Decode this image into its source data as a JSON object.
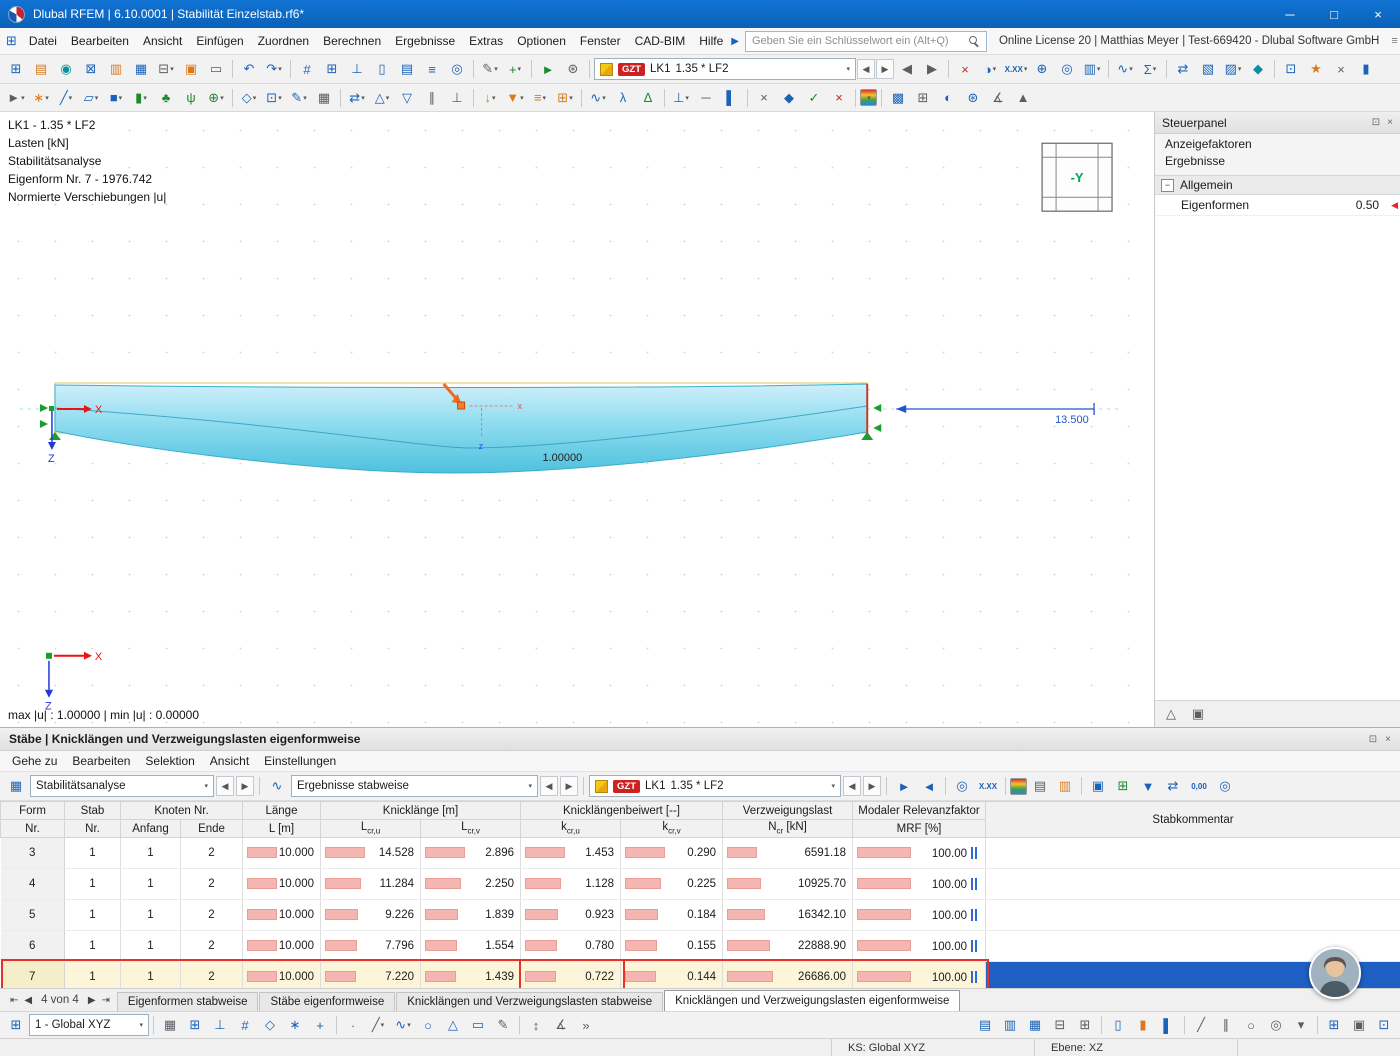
{
  "ui": {
    "caret": "▾",
    "prev": "◀",
    "next": "▶",
    "float": "⊡",
    "close": "×",
    "expander": "−",
    "more": "»",
    "appmenu": "⊞",
    "menu_list": "≡",
    "pin": "◆"
  },
  "titlebar": {
    "title": "Dlubal RFEM | 6.10.0001 | Stabilität Einzelstab.rf6*",
    "buttons": [
      {
        "g": "─",
        "n": "minimize-button"
      },
      {
        "g": "□",
        "n": "maximize-button"
      },
      {
        "g": "×",
        "n": "close-button"
      }
    ]
  },
  "menubar": {
    "items": [
      "Datei",
      "Bearbeiten",
      "Ansicht",
      "Einfügen",
      "Zuordnen",
      "Berechnen",
      "Ergebnisse",
      "Extras",
      "Optionen",
      "Fenster",
      "CAD-BIM",
      "Hilfe"
    ],
    "search_placeholder": "Geben Sie ein Schlüsselwort ein (Alt+Q)",
    "license_text": "Online License 20 | Matthias Meyer | Test-669420 - Dlubal Software GmbH"
  },
  "load_combo": {
    "badge": "GZT",
    "case": "LK1",
    "factor": "1.35 * LF2"
  },
  "viewport": {
    "overlay": [
      "LK1 - 1.35 * LF2",
      "Lasten [kN]",
      "Stabilitätsanalyse",
      "Eigenform Nr. 7 - 1976.742",
      "Normierte Verschiebungen |u|"
    ],
    "axis_x": "X",
    "axis_z": "Z",
    "mini_x": "x",
    "mini_z": "z",
    "beam_value": "1.00000",
    "dimension": "13.500",
    "navcube": "-Y",
    "status": "max |u| : 1.00000 | min |u| : 0.00000"
  },
  "sidepanel": {
    "title": "Steuerpanel",
    "links": [
      "Anzeigefaktoren",
      "Ergebnisse"
    ],
    "group": "Allgemein",
    "item_label": "Eigenformen",
    "item_value": "0.50"
  },
  "table": {
    "title": "Stäbe | Knicklängen und Verzweigungslasten eigenformweise",
    "menu": [
      "Gehe zu",
      "Bearbeiten",
      "Selektion",
      "Ansicht",
      "Einstellungen"
    ],
    "combo1": "Stabilitätsanalyse",
    "combo2": "Ergebnisse stabweise",
    "header": {
      "form_top": "Form",
      "form_bot": "Nr.",
      "stab_top": "Stab",
      "stab_bot": "Nr.",
      "knoten_top": "Knoten Nr.",
      "knoten_a": "Anfang",
      "knoten_e": "Ende",
      "laenge_top": "Länge",
      "laenge_bot": "L [m]",
      "knick_top": "Knicklänge [m]",
      "knick_u_pre": "L",
      "knick_u_sub": "cr,u",
      "knick_v_pre": "L",
      "knick_v_sub": "cr,v",
      "beiwert_top": "Knicklängenbeiwert [--]",
      "beiwert_u_pre": "k",
      "beiwert_u_sub": "cr,u",
      "beiwert_v_pre": "k",
      "beiwert_v_sub": "cr,v",
      "verzw_top": "Verzweigungslast",
      "verzw_pre": "N",
      "verzw_sub": "cr",
      "verzw_post": " [kN]",
      "mrf_top": "Modaler Relevanzfaktor",
      "mrf_bot": "MRF [%]",
      "kommentar": "Stabkommentar"
    },
    "rows": [
      {
        "form": "3",
        "stab": "1",
        "anfang": "1",
        "ende": "2",
        "laenge": "10.000",
        "lcru": "14.528",
        "lcrv": "2.896",
        "kcru": "1.453",
        "kcrv": "0.290",
        "ncr": "6591.18",
        "mrf": "100.00",
        "kommentar": ""
      },
      {
        "form": "4",
        "stab": "1",
        "anfang": "1",
        "ende": "2",
        "laenge": "10.000",
        "lcru": "11.284",
        "lcrv": "2.250",
        "kcru": "1.128",
        "kcrv": "0.225",
        "ncr": "10925.70",
        "mrf": "100.00",
        "kommentar": ""
      },
      {
        "form": "5",
        "stab": "1",
        "anfang": "1",
        "ende": "2",
        "laenge": "10.000",
        "lcru": "9.226",
        "lcrv": "1.839",
        "kcru": "0.923",
        "kcrv": "0.184",
        "ncr": "16342.10",
        "mrf": "100.00",
        "kommentar": ""
      },
      {
        "form": "6",
        "stab": "1",
        "anfang": "1",
        "ende": "2",
        "laenge": "10.000",
        "lcru": "7.796",
        "lcrv": "1.554",
        "kcru": "0.780",
        "kcrv": "0.155",
        "ncr": "22888.90",
        "mrf": "100.00",
        "kommentar": ""
      },
      {
        "form": "7",
        "stab": "1",
        "anfang": "1",
        "ende": "2",
        "laenge": "10.000",
        "lcru": "7.220",
        "lcrv": "1.439",
        "kcru": "0.722",
        "kcrv": "0.144",
        "ncr": "26686.00",
        "mrf": "100.00",
        "kommentar": "",
        "highlight": true
      }
    ],
    "pager": {
      "first": "⇤",
      "prev": "◀",
      "text": "4 von 4",
      "next": "▶",
      "last": "⇥"
    },
    "tabs": [
      "Eigenformen stabweise",
      "Stäbe eigenformweise",
      "Knicklängen und Verzweigungslasten stabweise",
      "Knicklängen und Verzweigungslasten eigenformweise"
    ],
    "active_tab": 3
  },
  "bottombar": {
    "combo": "1 - Global XYZ"
  },
  "statusbar": {
    "ks": "KS: Global XYZ",
    "ebene": "Ebene: XZ"
  },
  "toolbars": {
    "tb1a": [
      {
        "g": "⊞",
        "c": "blue",
        "n": "new-model-icon"
      },
      {
        "g": "▤",
        "c": "orange",
        "n": "open-model-icon"
      },
      {
        "g": "◉",
        "c": "teal",
        "n": "dlubal-online-icon"
      },
      {
        "g": "⊠",
        "c": "blue",
        "n": "import-icon"
      },
      {
        "g": "▥",
        "c": "orange",
        "n": "project-navigator-icon"
      },
      {
        "g": "▦",
        "c": "blue",
        "n": "save-icon"
      },
      {
        "g": "⊟",
        "c": "gray",
        "n": "print-icon",
        "d": 1
      },
      {
        "g": "▣",
        "c": "orange",
        "n": "copy-icon"
      },
      {
        "g": "▭",
        "c": "gray",
        "n": "clipboard-icon"
      },
      {
        "sep": 1
      },
      {
        "g": "↶",
        "c": "blue",
        "n": "undo-icon"
      },
      {
        "g": "↷",
        "c": "blue",
        "n": "redo-icon",
        "d": 1
      },
      {
        "sep": 1
      },
      {
        "g": "#",
        "c": "blue",
        "n": "grid-icon"
      },
      {
        "g": "⊞",
        "c": "blue",
        "n": "work-plane-icon"
      },
      {
        "g": "⊥",
        "c": "blue",
        "n": "snap-icon"
      },
      {
        "g": "▯",
        "c": "blue",
        "n": "window-layout-icon"
      },
      {
        "g": "▤",
        "c": "blue",
        "n": "tables-icon"
      },
      {
        "g": "≡",
        "c": "blue",
        "n": "printout-report-icon"
      },
      {
        "g": "◎",
        "c": "blue",
        "n": "visibility-icon"
      },
      {
        "sep": 1
      },
      {
        "g": "✎",
        "c": "gray",
        "n": "edit-mode-icon",
        "d": 1
      },
      {
        "g": "+",
        "c": "green",
        "n": "insert-object-icon",
        "d": 1
      },
      {
        "sep": 1
      },
      {
        "g": "►",
        "c": "green",
        "n": "calculate-icon"
      },
      {
        "g": "⊛",
        "c": "gray",
        "n": "calculation-settings-icon"
      },
      {
        "sep": 1
      }
    ],
    "tb1b": [
      {
        "g": "◀",
        "c": "gray",
        "n": "previous-load-case-icon"
      },
      {
        "g": "▶",
        "c": "gray",
        "n": "next-load-case-icon"
      },
      {
        "sep": 1
      },
      {
        "g": "×",
        "c": "red",
        "n": "delete-results-icon"
      },
      {
        "g": "◑",
        "c": "blue",
        "n": "show-results-icon",
        "d": 1
      },
      {
        "txt": "X.XX",
        "c": "blue",
        "n": "result-values-icon",
        "d": 1
      },
      {
        "g": "⊕",
        "c": "blue",
        "n": "zoom-values-icon"
      },
      {
        "g": "◎",
        "c": "blue",
        "n": "find-value-icon"
      },
      {
        "g": "▥",
        "c": "blue",
        "n": "result-diagram-icon",
        "d": 1
      },
      {
        "sep": 1
      },
      {
        "g": "∿",
        "c": "blue",
        "n": "result-smoothing-icon",
        "d": 1
      },
      {
        "g": "Σ",
        "c": "blue",
        "n": "result-sums-icon",
        "d": 1
      },
      {
        "sep": 1
      },
      {
        "g": "⇄",
        "c": "blue",
        "n": "compare-results-icon"
      },
      {
        "g": "▧",
        "c": "blue",
        "n": "section-view-icon"
      },
      {
        "g": "▨",
        "c": "blue",
        "n": "rendering-icon",
        "d": 1
      },
      {
        "g": "◆",
        "c": "teal",
        "n": "solid-display-icon"
      },
      {
        "sep": 1
      },
      {
        "g": "⊡",
        "c": "blue",
        "n": "clipping-box-icon"
      },
      {
        "g": "★",
        "c": "orange",
        "n": "favorites-icon"
      },
      {
        "g": "×",
        "c": "gray",
        "n": "close-views-icon"
      },
      {
        "g": "▮",
        "c": "blue",
        "n": "bar-display-icon"
      }
    ],
    "tb2": [
      {
        "g": "►",
        "c": "gray",
        "n": "select-pointer-icon",
        "d": 1
      },
      {
        "g": "∗",
        "c": "orange",
        "n": "new-node-icon",
        "d": 1
      },
      {
        "g": "╱",
        "c": "blue",
        "n": "new-line-icon",
        "d": 1
      },
      {
        "g": "▱",
        "c": "blue",
        "n": "new-surface-icon",
        "d": 1
      },
      {
        "g": "■",
        "c": "blue",
        "n": "new-solid-icon",
        "d": 1
      },
      {
        "g": "▮",
        "c": "green",
        "n": "new-member-icon",
        "d": 1
      },
      {
        "g": "♣",
        "c": "green",
        "n": "new-tree-icon"
      },
      {
        "g": "ψ",
        "c": "green",
        "n": "new-vegetation-icon"
      },
      {
        "g": "⊕",
        "c": "green",
        "n": "generate-objects-icon",
        "d": 1
      },
      {
        "sep": 1
      },
      {
        "g": "◇",
        "c": "blue",
        "n": "guide-line-icon",
        "d": 1
      },
      {
        "g": "⊡",
        "c": "blue",
        "n": "dimension-icon",
        "d": 1
      },
      {
        "g": "✎",
        "c": "blue",
        "n": "annotation-icon",
        "d": 1
      },
      {
        "g": "▦",
        "c": "gray",
        "n": "section-cut-icon"
      },
      {
        "sep": 1
      },
      {
        "g": "⇄",
        "c": "blue",
        "n": "move-copy-icon",
        "d": 1
      },
      {
        "g": "△",
        "c": "blue",
        "n": "rotate-icon",
        "d": 1
      },
      {
        "g": "▽",
        "c": "blue",
        "n": "mirror-icon"
      },
      {
        "g": "∥",
        "c": "gray",
        "n": "align-parallel-icon"
      },
      {
        "g": "⊥",
        "c": "gray",
        "n": "align-perpendicular-icon"
      },
      {
        "sep": 1
      },
      {
        "g": "↓",
        "c": "orange",
        "n": "nodal-load-icon",
        "d": 1
      },
      {
        "g": "▼",
        "c": "orange",
        "n": "member-load-icon",
        "d": 1
      },
      {
        "g": "≡",
        "c": "orange",
        "n": "surface-load-icon",
        "d": 1
      },
      {
        "g": "⊞",
        "c": "orange",
        "n": "load-wizard-icon",
        "d": 1
      },
      {
        "sep": 1
      },
      {
        "g": "∿",
        "c": "blue",
        "n": "imperfection-icon",
        "d": 1
      },
      {
        "g": "λ",
        "c": "blue",
        "n": "stability-analysis-icon"
      },
      {
        "g": "Δ",
        "c": "green",
        "n": "deformation-icon"
      },
      {
        "sep": 1
      },
      {
        "g": "⊥",
        "c": "blue",
        "n": "nodal-support-icon",
        "d": 1
      },
      {
        "g": "─",
        "c": "gray",
        "n": "member-hinge-icon"
      },
      {
        "g": "▌",
        "c": "blue",
        "n": "member-support-icon"
      },
      {
        "sep": 1
      },
      {
        "g": "×",
        "c": "gray",
        "n": "intersection-icon"
      },
      {
        "g": "◆",
        "c": "blue",
        "n": "cross-section-icon"
      },
      {
        "g": "✓",
        "c": "green",
        "n": "check-model-icon"
      },
      {
        "g": "×",
        "c": "red",
        "n": "delete-objects-icon"
      },
      {
        "sep": 1
      },
      {
        "swatch": 1,
        "n": "color-scale-icon",
        "d": 1
      },
      {
        "sep": 1
      },
      {
        "g": "▩",
        "c": "blue",
        "n": "mesh-icon"
      },
      {
        "g": "⊞",
        "c": "gray",
        "n": "mesh-settings-icon"
      },
      {
        "g": "◐",
        "c": "blue",
        "n": "display-properties-icon"
      },
      {
        "g": "⊛",
        "c": "blue",
        "n": "regenerate-icon"
      },
      {
        "g": "∡",
        "c": "gray",
        "n": "angle-icon"
      },
      {
        "g": "▲",
        "c": "gray",
        "n": "mirror-copy-icon"
      }
    ],
    "ttb": [
      {
        "g": "►",
        "c": "blue",
        "n": "select-in-graphic-icon"
      },
      {
        "g": "◄",
        "c": "blue",
        "n": "sync-selection-icon"
      },
      {
        "sep": 1
      },
      {
        "g": "◎",
        "c": "blue",
        "n": "view-values-icon"
      },
      {
        "txt": "X.XX",
        "c": "blue",
        "n": "table-values-icon"
      },
      {
        "sep": 1
      },
      {
        "swatch": 1,
        "n": "relation-bars-icon"
      },
      {
        "g": "▤",
        "c": "gray",
        "n": "export-table-icon"
      },
      {
        "g": "▥",
        "c": "orange",
        "n": "import-table-icon"
      },
      {
        "sep": 1
      },
      {
        "g": "▣",
        "c": "blue",
        "n": "dock-table-icon"
      },
      {
        "g": "⊞",
        "c": "green",
        "n": "export-html-icon"
      },
      {
        "g": "▼",
        "c": "blue",
        "n": "filter-icon"
      },
      {
        "g": "⇄",
        "c": "blue",
        "n": "transfer-icon"
      },
      {
        "txt": "0,00",
        "c": "blue",
        "n": "decimal-places-icon"
      },
      {
        "g": "◎",
        "c": "blue",
        "n": "search-table-icon"
      }
    ],
    "bb1": [
      {
        "g": "▦",
        "c": "gray",
        "n": "snap-grid-icon"
      },
      {
        "g": "⊞",
        "c": "blue",
        "n": "snap-points-icon"
      },
      {
        "g": "⊥",
        "c": "blue",
        "n": "ortho-mode-icon"
      },
      {
        "g": "#",
        "c": "blue",
        "n": "grid-toggle-icon"
      },
      {
        "g": "◇",
        "c": "blue",
        "n": "guidelines-toggle-icon"
      },
      {
        "g": "∗",
        "c": "blue",
        "n": "object-snap-icon"
      },
      {
        "g": "+",
        "c": "blue",
        "n": "crosshair-icon"
      },
      {
        "sep": 1
      },
      {
        "g": "∙",
        "c": "gray",
        "n": "point-tool-icon"
      },
      {
        "g": "╱",
        "c": "gray",
        "n": "line-tool-icon",
        "d": 1
      },
      {
        "g": "∿",
        "c": "blue",
        "n": "arc-tool-icon",
        "d": 1
      },
      {
        "g": "○",
        "c": "blue",
        "n": "circle-tool-icon"
      },
      {
        "g": "△",
        "c": "blue",
        "n": "polygon-tool-icon"
      },
      {
        "g": "▭",
        "c": "blue",
        "n": "rectangle-tool-icon"
      },
      {
        "g": "✎",
        "c": "gray",
        "n": "sketch-icon"
      },
      {
        "sep": 1
      },
      {
        "g": "↕",
        "c": "gray",
        "n": "measure-icon"
      },
      {
        "g": "∡",
        "c": "gray",
        "n": "angle-measure-icon"
      },
      {
        "g": "»",
        "c": "gray",
        "n": "more-tools-icon"
      }
    ],
    "bb2": [
      {
        "g": "▤",
        "c": "blue",
        "n": "view-1-icon"
      },
      {
        "g": "▥",
        "c": "blue",
        "n": "view-2-icon"
      },
      {
        "g": "▦",
        "c": "blue",
        "n": "view-3-icon"
      },
      {
        "g": "⊟",
        "c": "gray",
        "n": "split-view-icon"
      },
      {
        "g": "⊞",
        "c": "gray",
        "n": "merge-view-icon"
      },
      {
        "sep": 1
      },
      {
        "g": "▯",
        "c": "blue",
        "n": "workspace-icon"
      },
      {
        "g": "▮",
        "c": "orange",
        "n": "layers-icon"
      },
      {
        "g": "▌",
        "c": "blue",
        "n": "levels-icon"
      },
      {
        "sep": 1
      },
      {
        "g": "╱",
        "c": "gray",
        "n": "diagonal-view-icon"
      },
      {
        "g": "∥",
        "c": "gray",
        "n": "parallel-view-icon"
      },
      {
        "g": "○",
        "c": "gray",
        "n": "sphere-view-icon"
      },
      {
        "g": "◎",
        "c": "gray",
        "n": "target-view-icon"
      },
      {
        "g": "▾",
        "c": "gray",
        "n": "view-options-icon"
      },
      {
        "sep": 1
      },
      {
        "g": "⊞",
        "c": "blue",
        "n": "grid-settings-icon"
      },
      {
        "g": "▣",
        "c": "gray",
        "n": "plane-settings-icon"
      },
      {
        "g": "⊡",
        "c": "blue",
        "n": "frame-settings-icon"
      }
    ],
    "panel_footer": [
      {
        "g": "△",
        "c": "gray",
        "n": "render-mode-icon"
      },
      {
        "g": "▣",
        "c": "gray",
        "n": "panel-settings-icon"
      }
    ]
  },
  "colors": {
    "beam_top": "#cfeffa",
    "beam_bottom": "#4fc1de",
    "highlight_red": "#e8312a",
    "selection_blue": "#1d5fc2",
    "bar_pink": "#f5b5b0",
    "support_green": "#1a9e2f"
  }
}
